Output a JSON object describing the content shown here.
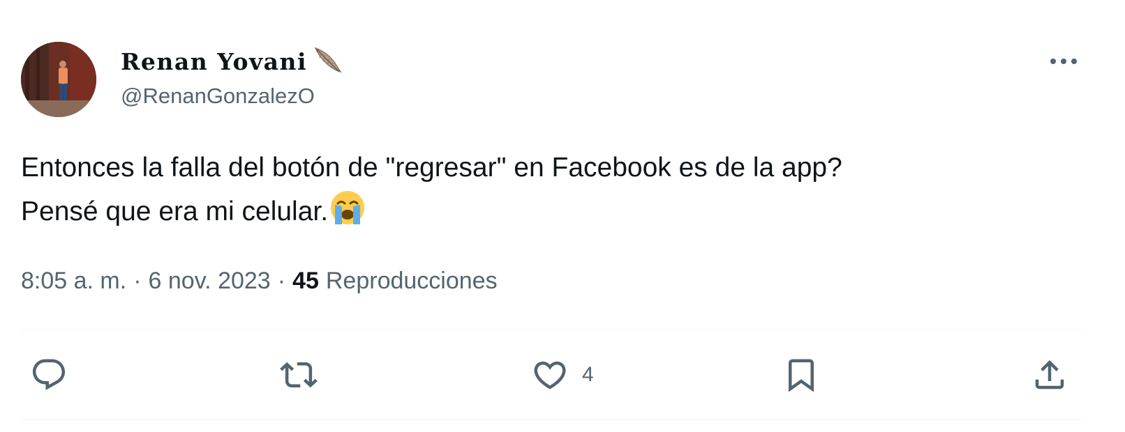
{
  "author": {
    "display_name": "Renan Yovani",
    "name_emoji": "feather-icon",
    "handle": "@RenanGonzalezO",
    "avatar": "avatar-photo"
  },
  "tweet": {
    "text_line_1": "Entonces la falla del botón de \"regresar\" en Facebook es de la app?",
    "text_line_2": "Pensé que era mi celular.",
    "text_emoji": "loudly-crying-face-icon"
  },
  "meta": {
    "time": "8:05 a. m.",
    "separator": "·",
    "date": "6 nov. 2023",
    "views_count": "45",
    "views_label": "Reproducciones"
  },
  "actions": {
    "reply": {
      "icon": "reply-icon",
      "count": ""
    },
    "retweet": {
      "icon": "retweet-icon",
      "count": ""
    },
    "like": {
      "icon": "heart-icon",
      "count": "4"
    },
    "bookmark": {
      "icon": "bookmark-icon",
      "count": ""
    },
    "share": {
      "icon": "share-icon",
      "count": ""
    }
  },
  "menu": {
    "icon": "more-options-icon"
  },
  "colors": {
    "text_primary": "#0f1419",
    "text_secondary": "#536471",
    "divider": "#eff3f4"
  }
}
